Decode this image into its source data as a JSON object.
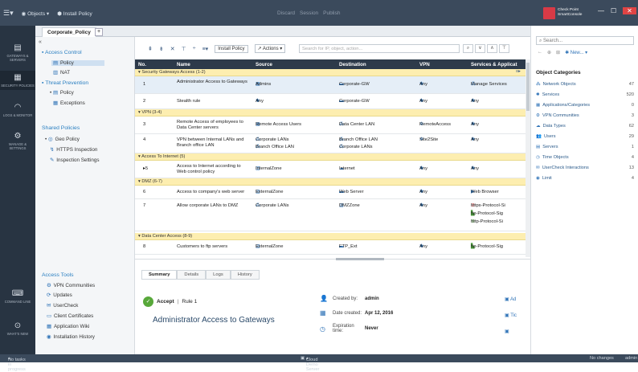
{
  "topbar": {
    "menu_icon": "menu-icon",
    "objects": "Objects",
    "install": "Install Policy",
    "discard": "Discard",
    "session": "Session",
    "publish": "Publish",
    "brand1": "Check Point",
    "brand2": "SmartConsole"
  },
  "rail": [
    {
      "label": "GATEWAYS & SERVERS",
      "icon": "gateways-icon"
    },
    {
      "label": "SECURITY POLICIES",
      "icon": "policies-icon"
    },
    {
      "label": "LOGS & MONITOR",
      "icon": "logs-icon"
    },
    {
      "label": "MANAGE & SETTINGS",
      "icon": "settings-icon"
    },
    {
      "label": "COMMAND LINE",
      "icon": "cmd-icon"
    },
    {
      "label": "WHAT'S NEW",
      "icon": "whatsnew-icon"
    }
  ],
  "tab": "Corporate_Policy",
  "policy_tree": {
    "access_control": "Access Control",
    "policy": "Policy",
    "nat": "NAT",
    "threat_prevention": "Threat Prevention",
    "tp_policy": "Policy",
    "exceptions": "Exceptions",
    "shared": "Shared Policies",
    "geo": "Geo Policy",
    "https": "HTTPS Inspection",
    "inspection": "Inspection Settings"
  },
  "access_tools": {
    "title": "Access Tools",
    "items": [
      "VPN Communities",
      "Updates",
      "UserCheck",
      "Client Certificates",
      "Application Wiki",
      "Installation History"
    ]
  },
  "toolbar": {
    "install": "Install Policy",
    "actions": "Actions",
    "search_placeholder": "Search for IP, object, action..."
  },
  "columns": [
    "No.",
    "Name",
    "Source",
    "Destination",
    "VPN",
    "Services & Applicat"
  ],
  "sections": [
    "Security Gateways Access (1-2)",
    "VPN (3-4)",
    "Access To Internet (5)",
    "DMZ (6-7)",
    "Data Center Access (8-9)"
  ],
  "rows": [
    {
      "no": "1",
      "name": "Administrator Access to Gateways",
      "src": "Admins",
      "dst": "Corporate-GW",
      "vpn": "Any",
      "svc": "Manage Services"
    },
    {
      "no": "2",
      "name": "Stealth rule",
      "src": "Any",
      "dst": "Corporate-GW",
      "vpn": "Any",
      "svc": "Any"
    },
    {
      "no": "3",
      "name": "Remote Access of employees to Data Center servers",
      "src": "Remote Access Users",
      "dst": "Data Center LAN",
      "vpn": "RemoteAccess",
      "svc": "Any"
    },
    {
      "no": "4",
      "name": "VPN between Internal LANs and Branch office LAN",
      "src": "Corporate LANs",
      "src2": "Branch Office LAN",
      "dst": "Branch Office LAN",
      "dst2": "Corporate LANs",
      "vpn": "Site2Site",
      "svc": "Any"
    },
    {
      "no": "5",
      "name": "Access to Internet according to Web control policy",
      "src": "InternalZone",
      "dst": "Internet",
      "vpn": "Any",
      "svc": "Any"
    },
    {
      "no": "6",
      "name": "Access to company's web server",
      "src": "ExternalZone",
      "dst": "Web Server",
      "vpn": "Any",
      "svc": "Web Browser"
    },
    {
      "no": "7",
      "name": "Allow corporate LANs to DMZ",
      "src": "Corporate LANs",
      "dst": "DMZZone",
      "vpn": "Any",
      "svc": "https-Protocol-Si",
      "svc2": "ftp-Protocol-Sig",
      "svc3": "http-Protocol-Si"
    },
    {
      "no": "8",
      "name": "Customers to ftp servers",
      "src": "ExternalZone",
      "dst": "FTP_Ext",
      "vpn": "Any",
      "svc": "ftp-Protocol-Sig"
    }
  ],
  "details": {
    "tabs": [
      "Summary",
      "Details",
      "Logs",
      "History"
    ],
    "action": "Accept",
    "rule": "Rule 1",
    "title": "Administrator Access to Gateways",
    "created_by_k": "Created by:",
    "created_by_v": "admin",
    "date_k": "Date created:",
    "date_v": "Apr 12, 2016",
    "exp_k": "Expiration time:",
    "exp_v": "Never",
    "right1": "Ad",
    "right2": "Tic"
  },
  "rpanel": {
    "search": "Search...",
    "new": "New...",
    "title": "Object Categories",
    "items": [
      {
        "label": "Network Objects",
        "count": "47"
      },
      {
        "label": "Services",
        "count": "520"
      },
      {
        "label": "Applications/Categories",
        "count": "0"
      },
      {
        "label": "VPN Communities",
        "count": "3"
      },
      {
        "label": "Data Types",
        "count": "62"
      },
      {
        "label": "Users",
        "count": "29"
      },
      {
        "label": "Servers",
        "count": "1"
      },
      {
        "label": "Time Objects",
        "count": "4"
      },
      {
        "label": "UserCheck Interactions",
        "count": "13"
      },
      {
        "label": "Limit",
        "count": "4"
      }
    ]
  },
  "status": {
    "left": "No tasks in progress",
    "center": "Cloud Demo Server",
    "right": "No changes",
    "user": "admin"
  }
}
